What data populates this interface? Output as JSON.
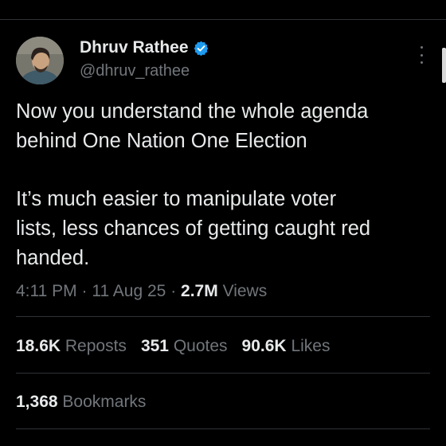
{
  "author": {
    "display_name": "Dhruv Rathee",
    "handle": "@dhruv_rathee",
    "verified_icon": "verified-badge-icon",
    "verified_color": "#1d9bf0"
  },
  "tweet": {
    "paragraphs": [
      "Now you understand the whole agenda\nbehind One Nation One Election",
      "It’s much easier to manipulate voter\nlists, less chances of getting caught red\nhanded."
    ],
    "time": "4:11 PM",
    "date": "11 Aug 25",
    "views_count": "2.7M",
    "views_label": "Views"
  },
  "stats": {
    "reposts_count": "18.6K",
    "reposts_label": "Reposts",
    "quotes_count": "351",
    "quotes_label": "Quotes",
    "likes_count": "90.6K",
    "likes_label": "Likes",
    "bookmarks_count": "1,368",
    "bookmarks_label": "Bookmarks"
  },
  "colors": {
    "background": "#000000",
    "text_primary": "#e7e9ea",
    "text_secondary": "#71767b",
    "divider": "#2f3336"
  }
}
